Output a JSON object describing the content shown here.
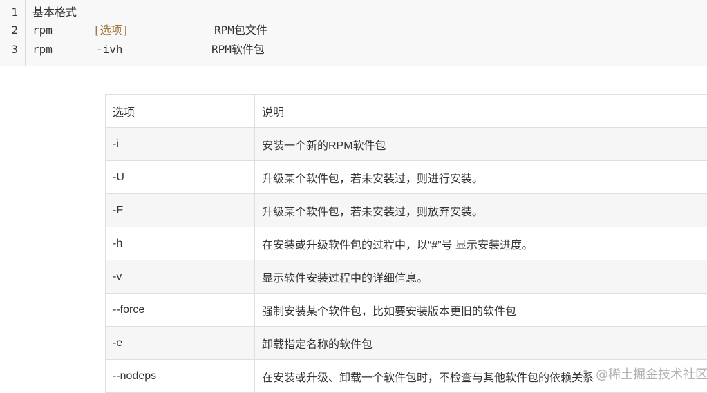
{
  "code": {
    "line_numbers": [
      "1",
      "2",
      "3"
    ],
    "line1": "基本格式",
    "line2": {
      "cmd": "rpm",
      "option": "[选项]",
      "desc": "RPM包文件"
    },
    "line3": {
      "cmd": "rpm",
      "option": "-ivh",
      "desc": "RPM软件包"
    }
  },
  "table": {
    "headers": [
      "选项",
      "说明"
    ],
    "rows": [
      {
        "option": "-i",
        "desc": "安装一个新的RPM软件包"
      },
      {
        "option": "-U",
        "desc": "升级某个软件包，若未安装过，则进行安装。"
      },
      {
        "option": "-F",
        "desc": "升级某个软件包，若未安装过，则放弃安装。"
      },
      {
        "option": "-h",
        "desc": "在安装或升级软件包的过程中，以“#”号 显示安装进度。"
      },
      {
        "option": "-v",
        "desc": "显示软件安装过程中的详细信息。"
      },
      {
        "option": "--force",
        "desc": "强制安装某个软件包，比如要安装版本更旧的软件包"
      },
      {
        "option": "-e",
        "desc": "卸载指定名称的软件包"
      },
      {
        "option": "--nodeps",
        "desc": "在安装或升级、卸载一个软件包时，不检查与其他软件包的依赖关系"
      }
    ]
  },
  "watermark": {
    "text": "@稀土掘金技术社区",
    "icon": "juejin-logo-icon"
  }
}
